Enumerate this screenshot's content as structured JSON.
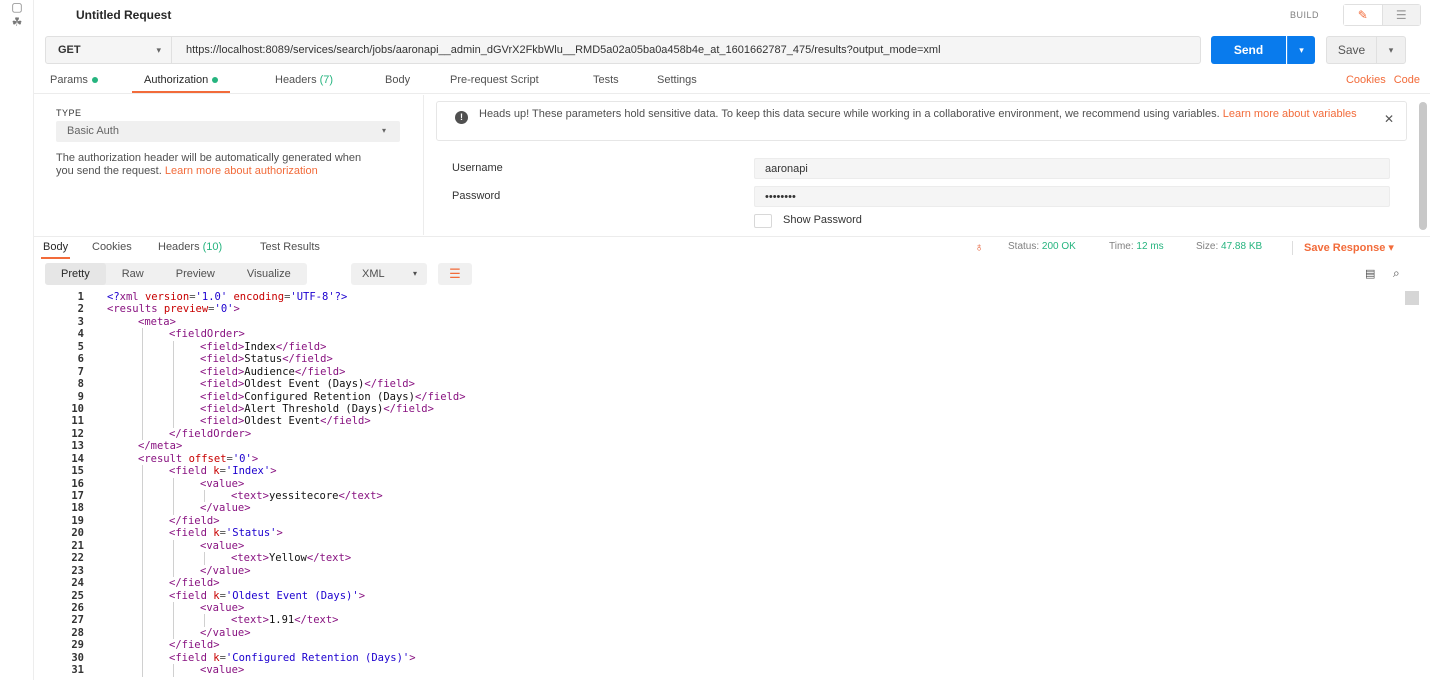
{
  "header": {
    "title": "Untitled Request",
    "build_label": "BUILD",
    "pencil_icon": "✎",
    "comment_icon": "☰"
  },
  "rail": {
    "icon_top": "▢",
    "icon_team": "☘"
  },
  "url_bar": {
    "method": "GET",
    "url": "https://localhost:8089/services/search/jobs/aaronapi__admin_dGVrX2FkbWlu__RMD5a02a05ba0a458b4e_at_1601662787_475/results?output_mode=xml",
    "send_label": "Send",
    "save_label": "Save",
    "caret": "▾"
  },
  "request_tabs": {
    "params": "Params",
    "authorization": "Authorization",
    "headers": "Headers",
    "headers_count": "(7)",
    "body": "Body",
    "prerequest": "Pre-request Script",
    "tests": "Tests",
    "settings": "Settings",
    "cookies": "Cookies",
    "code": "Code"
  },
  "auth": {
    "type_label": "TYPE",
    "type_value": "Basic Auth",
    "note": "The authorization header will be automatically generated when you send the request.",
    "note_link": "Learn more about authorization",
    "notice_text": "Heads up! These parameters hold sensitive data. To keep this data secure while working in a collaborative environment, we recommend using variables.",
    "notice_link": "Learn more about variables",
    "notice_icon": "!",
    "close_icon": "✕",
    "username_label": "Username",
    "username_value": "aaronapi",
    "password_label": "Password",
    "password_value": "••••••••",
    "show_password": "Show Password"
  },
  "response_tabs": {
    "body": "Body",
    "cookies": "Cookies",
    "headers": "Headers",
    "headers_count": "(10)",
    "test_results": "Test Results",
    "status_label": "Status:",
    "status_value": "200 OK",
    "time_label": "Time:",
    "time_value": "12 ms",
    "size_label": "Size:",
    "size_value": "47.88 KB",
    "save_response": "Save Response",
    "globe_icon": "♁"
  },
  "viewer": {
    "pretty": "Pretty",
    "raw": "Raw",
    "preview": "Preview",
    "visualize": "Visualize",
    "format": "XML",
    "wrap_icon": "☰",
    "copy_icon": "▤",
    "search_icon": "⌕"
  },
  "code_lines": [
    "<?xml version='1.0' encoding='UTF-8'?>",
    "<results preview='0'>",
    "<meta>",
    "<fieldOrder>",
    "<field>Index</field>",
    "<field>Status</field>",
    "<field>Audience</field>",
    "<field>Oldest Event (Days)</field>",
    "<field>Configured Retention (Days)</field>",
    "<field>Alert Threshold (Days)</field>",
    "<field>Oldest Event</field>",
    "</fieldOrder>",
    "</meta>",
    "<result offset='0'>",
    "<field k='Index'>",
    "<value>",
    "<text>yessitecore</text>",
    "</value>",
    "</field>",
    "<field k='Status'>",
    "<value>",
    "<text>Yellow</text>",
    "</value>",
    "</field>",
    "<field k='Oldest Event (Days)'>",
    "<value>",
    "<text>1.91</text>",
    "</value>",
    "</field>",
    "<field k='Configured Retention (Days)'>",
    "<value>"
  ]
}
